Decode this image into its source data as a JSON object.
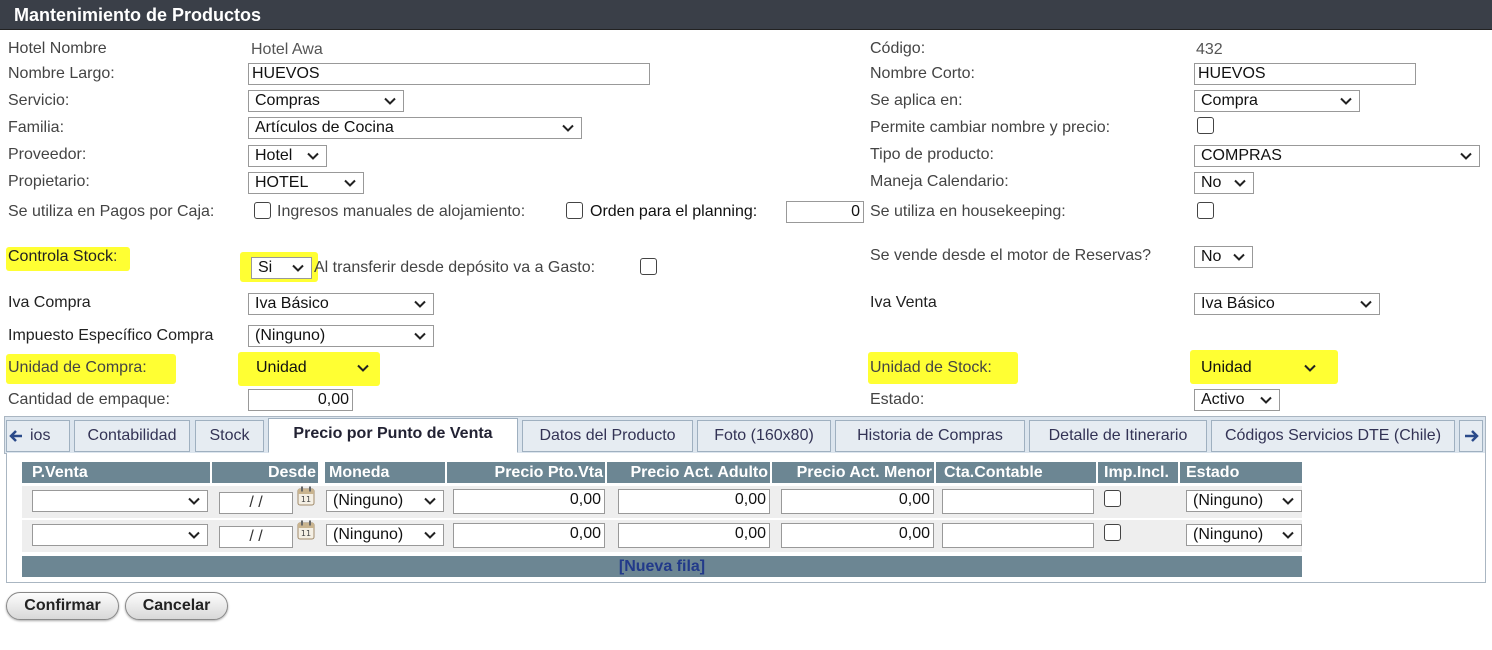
{
  "title": "Mantenimiento de Productos",
  "labels": {
    "hotel_nombre": "Hotel Nombre",
    "codigo": "Código:",
    "nombre_largo": "Nombre Largo:",
    "nombre_corto": "Nombre Corto:",
    "servicio": "Servicio:",
    "se_aplica_en": "Se aplica en:",
    "familia": "Familia:",
    "permite_cambiar": "Permite cambiar nombre y precio:",
    "proveedor": "Proveedor:",
    "tipo_producto": "Tipo de producto:",
    "propietario": "Propietario:",
    "maneja_calendario": "Maneja Calendario:",
    "pagos_caja": "Se utiliza en Pagos por Caja:",
    "ingresos_manuales": "Ingresos manuales de alojamiento:",
    "orden_planning": "Orden para el planning:",
    "housekeeping": "Se utiliza en housekeeping:",
    "controla_stock": "Controla Stock",
    "controla_stock_colon": ":",
    "transferir_gasto": "Al transferir desde depósito va a Gasto:",
    "motor_reservas": "Se vende desde el motor de Reservas?",
    "iva_compra": "Iva Compra",
    "iva_venta": "Iva Venta",
    "impuesto_especifico": "Impuesto Específico Compra",
    "unidad_compra": "Unidad de Compra:",
    "unidad_stock": "Unidad de Stock:",
    "cantidad_empaque": "Cantidad de empaque:",
    "estado": "Estado:"
  },
  "values": {
    "hotel_nombre": "Hotel Awa",
    "codigo": "432",
    "nombre_largo": "HUEVOS",
    "nombre_corto": "HUEVOS",
    "servicio": "Compras",
    "se_aplica_en": "Compra",
    "familia": "Artículos de Cocina",
    "proveedor": "Hotel",
    "tipo_producto": "COMPRAS",
    "propietario": "HOTEL",
    "maneja_calendario": "No",
    "orden_planning": "0",
    "controla_stock": "Si",
    "motor_reservas": "No",
    "iva_compra": "Iva Básico",
    "iva_venta": "Iva Básico",
    "impuesto_especifico": "(Ninguno)",
    "unidad_compra": "Unidad",
    "unidad_stock": "Unidad",
    "cantidad_empaque": "0,00",
    "estado": "Activo"
  },
  "tabs": [
    "ios",
    "Contabilidad",
    "Stock",
    "Precio por Punto de Venta",
    "Datos del Producto",
    "Foto (160x80)",
    "Historia de Compras",
    "Detalle de Itinerario",
    "Códigos Servicios DTE (Chile)"
  ],
  "grid": {
    "headers": [
      "P.Venta",
      "Desde",
      "Moneda",
      "Precio Pto.Vta",
      "Precio Act. Adulto",
      "Precio Act. Menor",
      "Cta.Contable",
      "Imp.Incl.",
      "Estado"
    ],
    "rows": [
      {
        "pventa": "",
        "desde": "/ /",
        "moneda": "(Ninguno)",
        "precio_pto": "0,00",
        "precio_adulto": "0,00",
        "precio_menor": "0,00",
        "cta": "",
        "estado": "(Ninguno)"
      },
      {
        "pventa": "",
        "desde": "/ /",
        "moneda": "(Ninguno)",
        "precio_pto": "0,00",
        "precio_adulto": "0,00",
        "precio_menor": "0,00",
        "cta": "",
        "estado": "(Ninguno)"
      }
    ],
    "new_row": "[Nueva fila]"
  },
  "buttons": {
    "confirm": "Confirmar",
    "cancel": "Cancelar"
  },
  "colors": {
    "highlight": "#ffff33",
    "grid_header": "#6c8693",
    "titlebar": "#3a3f48"
  }
}
